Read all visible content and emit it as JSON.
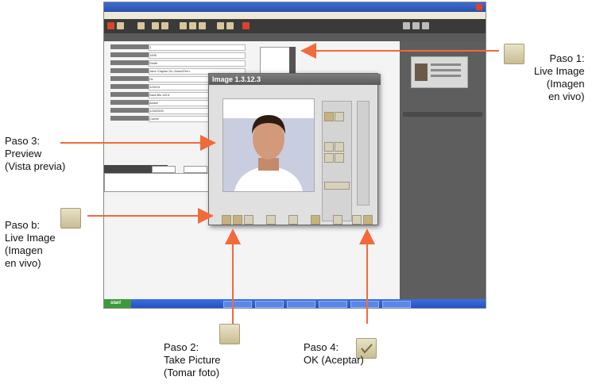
{
  "screen": {
    "window_title": "",
    "dialog_title": "Image 1.3.12.3",
    "form_values": [
      "1",
      "1495",
      "Smith",
      "Jane Clayton Du Jones/Fern",
      "HL",
      "1/15/14",
      "Sara Blu 4/0.6",
      "Active",
      "1/18/2000",
      "Combi"
    ],
    "taskbar_start": "start"
  },
  "annotations": {
    "step1": {
      "line1": "Paso 1:",
      "line2": "Live Image",
      "line3": "(Imagen",
      "line4": "en vivo)",
      "icon": "live-image-icon"
    },
    "step3": {
      "line1": "Paso 3:",
      "line2": "Preview",
      "line3": "(Vista previa)"
    },
    "stepb": {
      "line1": "Paso b:",
      "line2": "Live Image",
      "line3": "(Imagen",
      "line4": "en vivo)",
      "icon": "live-image-icon"
    },
    "step2": {
      "line1": "Paso 2:",
      "line2": "Take Picture",
      "line3": "(Tomar foto)",
      "icon": "take-picture-icon"
    },
    "step4": {
      "line1": "Paso 4:",
      "line2": "OK (Aceptar)",
      "icon": "ok-check-icon"
    }
  },
  "colors": {
    "arrow": "#f26a3a",
    "dark_panel": "#5e5e5e",
    "toolbar": "#3a3a3a"
  }
}
